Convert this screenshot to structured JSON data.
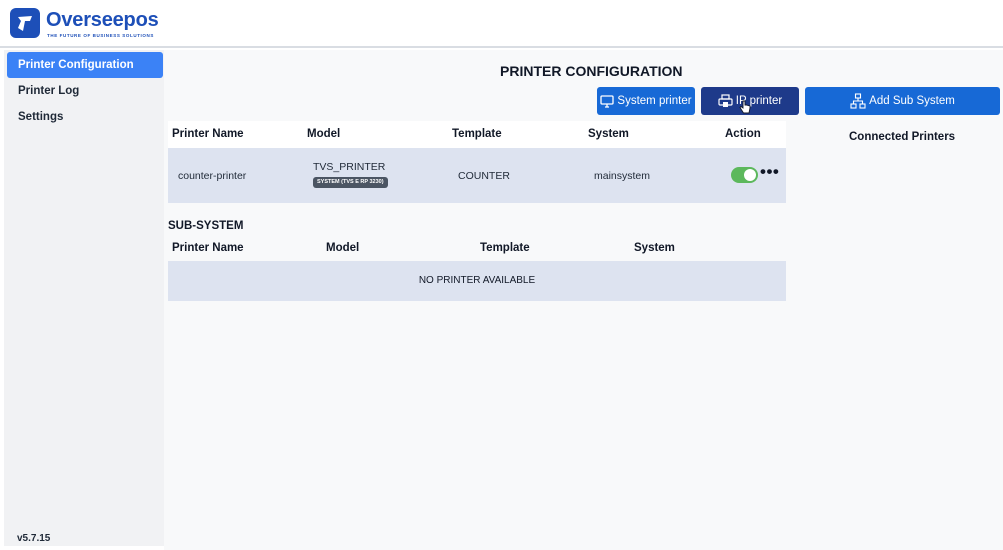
{
  "app": {
    "logo_text": "Overseepos",
    "tagline": "THE FUTURE OF BUSINESS SOLUTIONS",
    "brand_color": "#1d4fb8",
    "version": "v5.7.15"
  },
  "sidebar": {
    "items": [
      {
        "label": "Printer Configuration",
        "active": true
      },
      {
        "label": "Printer Log",
        "active": false
      },
      {
        "label": "Settings",
        "active": false
      }
    ],
    "active_color": "#3b82f6"
  },
  "page": {
    "title": "PRINTER CONFIGURATION"
  },
  "toolbar": {
    "system_printer": {
      "label": "System printer",
      "icon": "monitor-icon"
    },
    "ip_printer": {
      "label": "IP printer",
      "icon": "printer-lock-icon"
    },
    "add_sub_system": {
      "label": "Add Sub System",
      "icon": "network-icon"
    }
  },
  "connected_printers": {
    "label": "Connected Printers"
  },
  "main_table": {
    "columns": [
      "Printer Name",
      "Model",
      "Template",
      "System",
      "Action"
    ],
    "rows": [
      {
        "printer_name": "counter-printer",
        "model": "TVS_PRINTER",
        "model_badge": "SYSTEM (TVS E RP 3230)",
        "template": "COUNTER",
        "system": "mainsystem",
        "enabled": true,
        "more": "•••"
      }
    ]
  },
  "sub_system": {
    "title": "SUB-SYSTEM",
    "columns": [
      "Printer Name",
      "Model",
      "Template",
      "System"
    ],
    "empty_text": "NO PRINTER AVAILABLE"
  }
}
